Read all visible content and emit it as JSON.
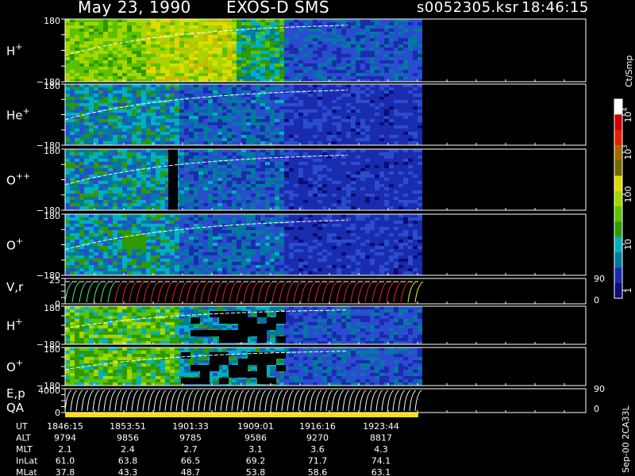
{
  "header": {
    "date_label": "May 23, 1990",
    "instrument_label": "EXOS-D SMS",
    "file_label": "s0052305.ksr",
    "time_label": "18:46:15"
  },
  "panels": [
    {
      "label_main": "H",
      "label_sup": "+",
      "axis_top": "180",
      "axis_bottom": "−180"
    },
    {
      "label_main": "He",
      "label_sup": "+",
      "axis_top": "180",
      "axis_bottom": "−180"
    },
    {
      "label_main": "O",
      "label_sup": "++",
      "axis_top": "180",
      "axis_bottom": "−180"
    },
    {
      "label_main": "O",
      "label_sup": "+",
      "axis_top": "180",
      "axis_bottom": "−180"
    },
    {
      "label_main": "V,r",
      "label_sup": "",
      "axis_top": "25",
      "axis_bottom": "0",
      "right_top": "90",
      "right_bottom": "0"
    },
    {
      "label_main": "H",
      "label_sup": "+",
      "axis_top": "180",
      "axis_bottom": "−180"
    },
    {
      "label_main": "O",
      "label_sup": "+",
      "axis_top": "180",
      "axis_bottom": "−180"
    },
    {
      "label_main": "E,p",
      "label_sup": "",
      "label_second": "QA",
      "axis_top": "4000",
      "axis_bottom": "0",
      "right_top": "90",
      "right_bottom": "0"
    }
  ],
  "colorbar": {
    "unit": "Ct/Smp",
    "ticks": [
      {
        "label": "10",
        "sup": "4"
      },
      {
        "label": "10",
        "sup": "3"
      },
      {
        "label": "100",
        "sup": ""
      },
      {
        "label": "10",
        "sup": ""
      },
      {
        "label": "1",
        "sup": ""
      }
    ],
    "colors": [
      "#ffffff",
      "#c80000",
      "#e82000",
      "#a06a00",
      "#6e6a00",
      "#dcdc00",
      "#a6d600",
      "#5cc200",
      "#2f9a00",
      "#00b0c0",
      "#007a9e",
      "#1a2cae",
      "#0c0c74"
    ]
  },
  "footer": {
    "version": "Sep-00 2CA33L",
    "rows": [
      {
        "label": "UT",
        "values": [
          "1846:15",
          "1853:51",
          "1901:33",
          "1909:01",
          "1916:16",
          "1923:44"
        ]
      },
      {
        "label": "ALT",
        "values": [
          "9794",
          "9856",
          "9785",
          "9586",
          "9270",
          "8817"
        ]
      },
      {
        "label": "MLT",
        "values": [
          "2.1",
          "2.4",
          "2.7",
          "3.1",
          "3.6",
          "4.3"
        ]
      },
      {
        "label": "InLat",
        "values": [
          "61.0",
          "63.8",
          "66.5",
          "69.2",
          "71.7",
          "74.1"
        ]
      },
      {
        "label": "MLat",
        "values": [
          "37.8",
          "43.3",
          "48.7",
          "53.8",
          "58.6",
          "63.1"
        ]
      }
    ]
  },
  "chart_data": {
    "type": "heatmap",
    "x_ticks": [
      "1846:15",
      "1853:51",
      "1901:33",
      "1909:01",
      "1916:16",
      "1923:44"
    ],
    "panels": [
      "H+",
      "He+",
      "O++",
      "O+",
      "V,r",
      "H+",
      "O+",
      "E,p"
    ],
    "colorbar_scale": "log",
    "colorbar_range": [
      1,
      10000
    ],
    "colorbar_unit": "Ct/Smp"
  }
}
